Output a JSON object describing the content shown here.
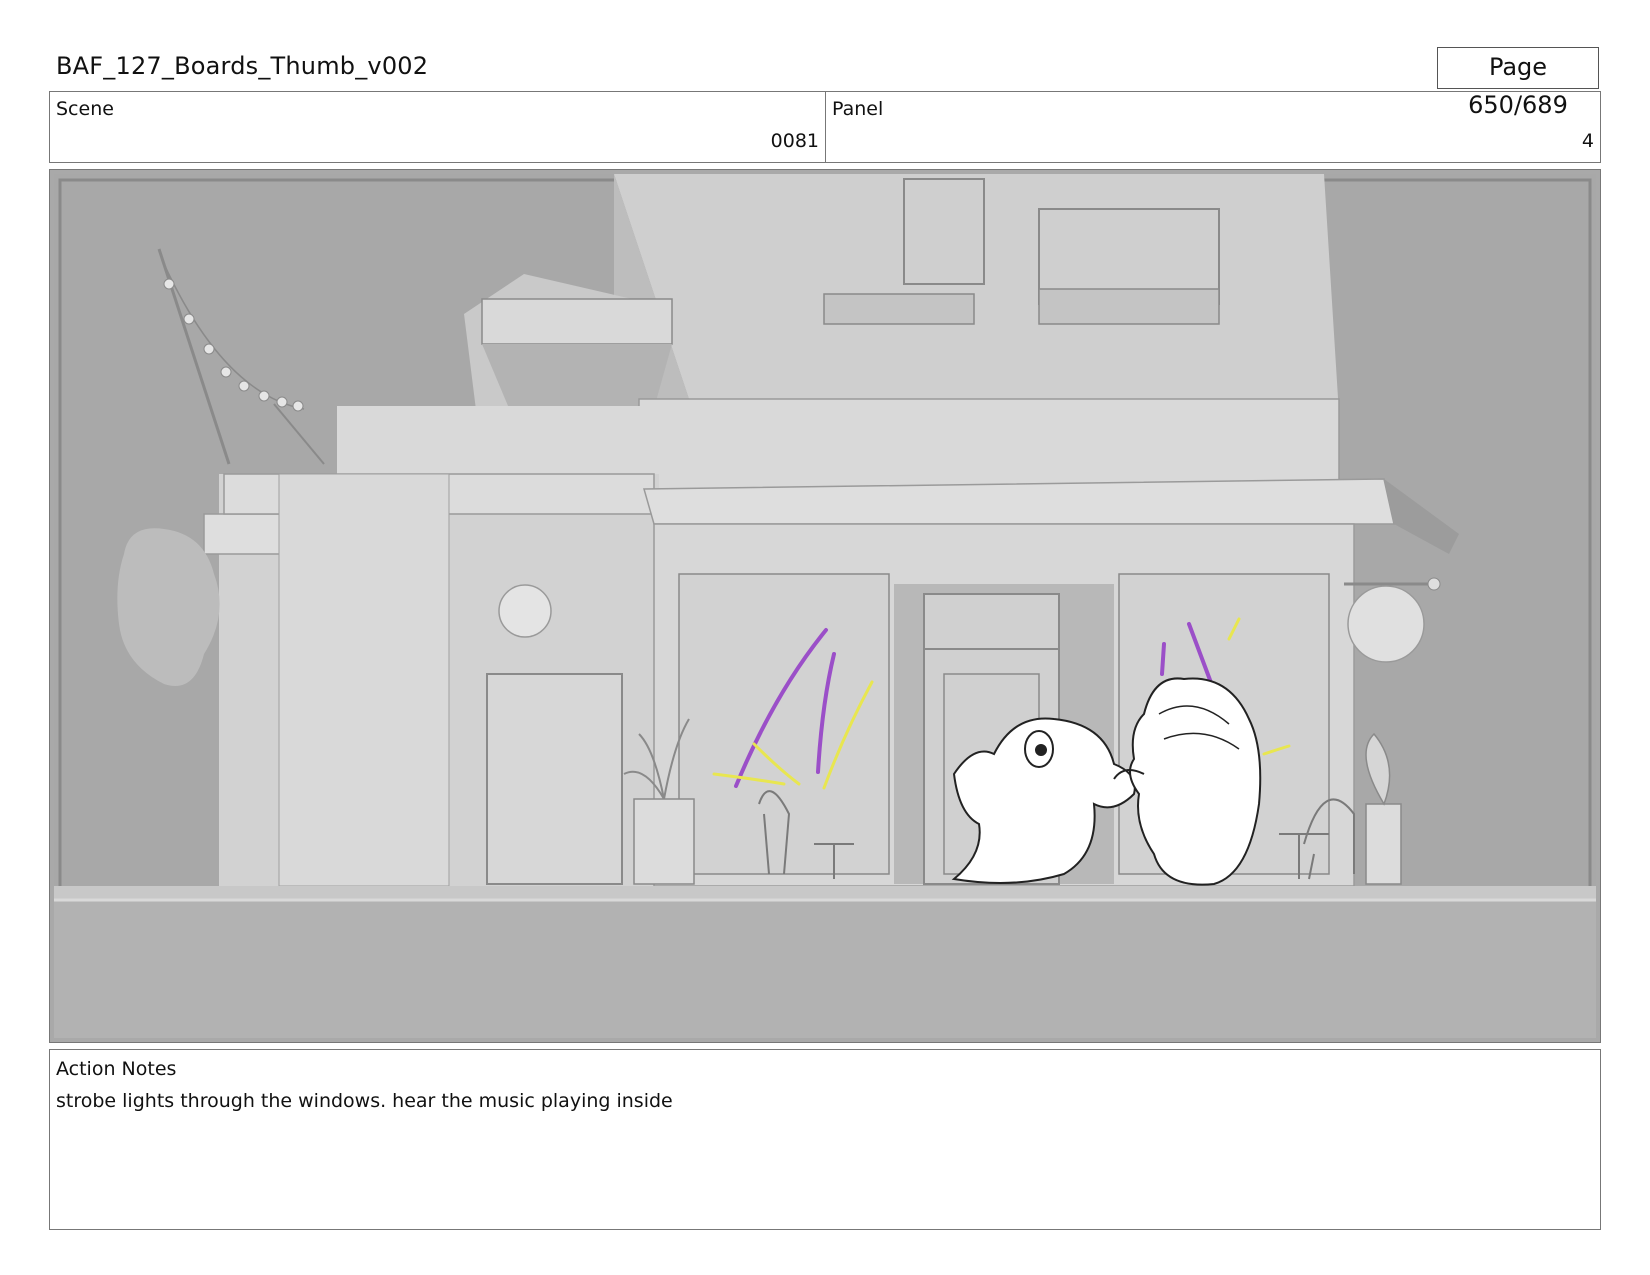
{
  "header": {
    "title": "BAF_127_Boards_Thumb_v002",
    "page": "Page 650/689"
  },
  "info": {
    "scene_label": "Scene",
    "scene_value": "0081",
    "panel_label": "Panel",
    "panel_value": "4"
  },
  "notes": {
    "label": "Action Notes",
    "text": "strobe lights through the windows. hear the music playing inside"
  },
  "colors": {
    "strobe_purple": "#9b4fc8",
    "strobe_yellow": "#e8e650",
    "building": "#d6d6d6",
    "sky": "#a9a9a9"
  }
}
